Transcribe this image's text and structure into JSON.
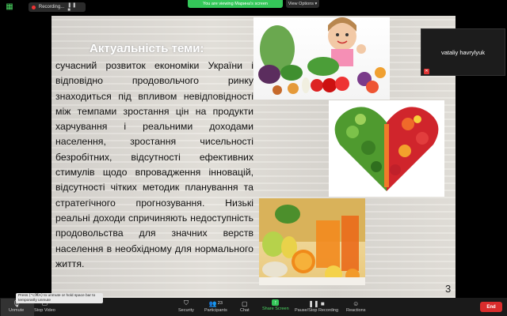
{
  "top_bar": {
    "recording_label": "Recording...",
    "recording_controls": "❚❚ ■",
    "viewing_banner": "You are viewing Марина's screen",
    "view_options": "View Options ▾"
  },
  "slide": {
    "title": "Актуальність теми:",
    "body": "сучасний розвиток економіки України і відповідно продовольчого ринку знаходиться під впливом невідповідності між темпами зростання цін на продукти харчування і реальними доходами населення, зростання чисельності безробітних, відсутності ефективних стимулів щодо впровадження інновацій, відсутності чітких методик планування та стратегічного прогнозування. Низькі реальні доходи спричиняють недоступність продовольства для значних верств населення в необхідному для нормального життя.",
    "page_number": "3"
  },
  "participant": {
    "name": "vataliy havrylyuk"
  },
  "tooltip": {
    "text": "Press ⟨⌥⌘A⟩ to unmute or hold space bar to temporarily unmute"
  },
  "toolbar": {
    "unmute": "Unmute",
    "stop_video": "Stop Video",
    "security": "Security",
    "participants": "Participants",
    "participants_count": "23",
    "chat": "Chat",
    "share_screen": "Share Screen",
    "pause_stop_recording": "Pause/Stop Recording",
    "reactions": "Reactions",
    "end": "End"
  },
  "colors": {
    "accent_green": "#34c759",
    "end_red": "#d92c2c",
    "mute_red": "#dd3333"
  }
}
